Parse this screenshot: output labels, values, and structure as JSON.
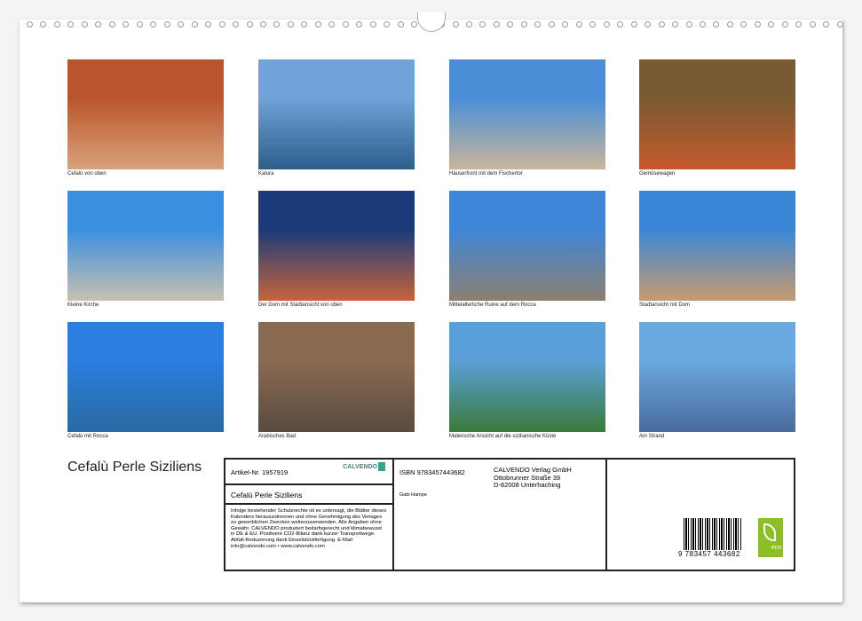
{
  "photos": [
    {
      "caption": "Cefalù von oben",
      "colors": [
        "#b9552c",
        "#d8a27a"
      ]
    },
    {
      "caption": "Kalura",
      "colors": [
        "#6fa3d9",
        "#2c5f8a"
      ]
    },
    {
      "caption": "Häuserfront mit dem Fischertor",
      "colors": [
        "#4a8ed8",
        "#c9b59a"
      ]
    },
    {
      "caption": "Gemüsewagen",
      "colors": [
        "#7a5a32",
        "#c55a2c"
      ]
    },
    {
      "caption": "Kleine Kirche",
      "colors": [
        "#3a8fe0",
        "#c8c0b0"
      ]
    },
    {
      "caption": "Der Dom mit Stadtansicht von oben",
      "colors": [
        "#1a3a7a",
        "#c8643a"
      ]
    },
    {
      "caption": "Mittelalterliche Ruine auf dem Rocca",
      "colors": [
        "#3f86d8",
        "#8c8070"
      ]
    },
    {
      "caption": "Stadtansicht mit Dom",
      "colors": [
        "#3a86d6",
        "#c89a70"
      ]
    },
    {
      "caption": "Cefalù mit Rocca",
      "colors": [
        "#2a7fe0",
        "#2a6aa0"
      ]
    },
    {
      "caption": "Arabisches Bad",
      "colors": [
        "#8a6a50",
        "#5a4a40"
      ]
    },
    {
      "caption": "Malerische Ansicht auf die sizilianische Küste",
      "colors": [
        "#5aa0d8",
        "#3a7a3a"
      ]
    },
    {
      "caption": "Am Strand",
      "colors": [
        "#6aa8e0",
        "#4a6a9a"
      ]
    }
  ],
  "title": "Cefalù Perle Siziliens",
  "info": {
    "article": "Artikel-Nr. 1957919",
    "logo": "CALVENDO",
    "name": "Cefalù Perle Siziliens",
    "legal": "Infolge bestehender Schutzrechte ist es untersagt, die Blätter dieses Kalenders herauszutrennen und ohne Genehmigung des Verlages zu gewerblichen Zwecken weiterzuverwenden. Alle Angaben ohne Gewähr. CALVENDO produziert bedarfsgerecht und klimabewusst in DE & EU. Positivere CO2-Bilanz dank kurzer Transportwege. Abfall-Reduzierung dank Einzelstückfertigung. E-Mail: info@calvendo.com • www.calvendo.com",
    "isbn": "ISBN 9783457443682",
    "publisher": [
      "CALVENDO Verlag GmbH",
      "Ottobrunner Straße 39",
      "D-82008 Unterhaching"
    ],
    "author": "Gabi Hampe",
    "barcode_number": "9 783457 443682",
    "eco_label": "eco",
    "eco_color": "#8cbf26"
  }
}
